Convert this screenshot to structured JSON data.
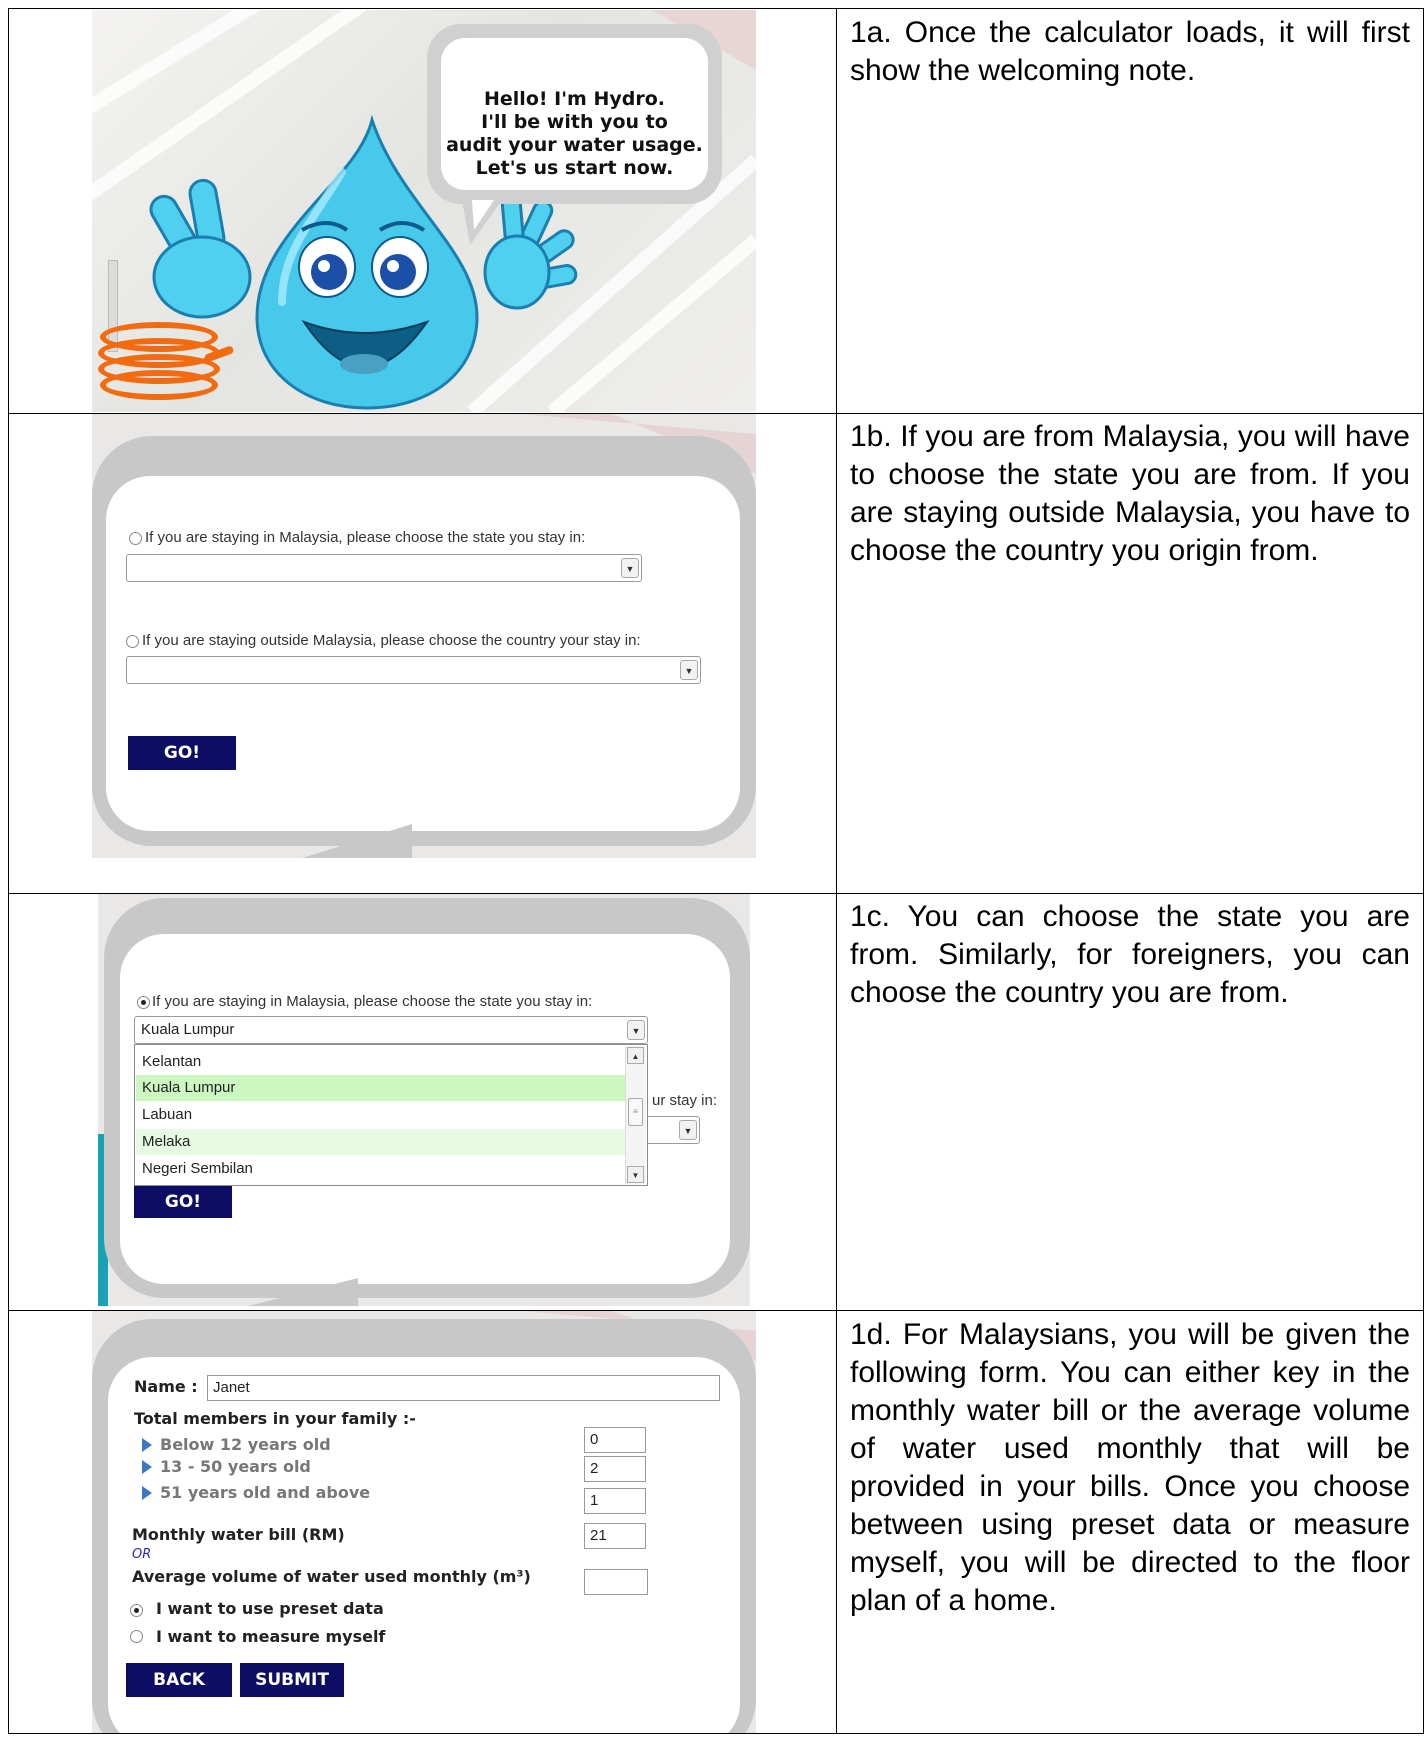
{
  "panelA": {
    "bubble_lines": [
      "Hello! I'm Hydro.",
      "I'll be with you to",
      "audit your water usage.",
      "Let's us start now."
    ],
    "description": "1a. Once the calculator loads, it will first show the welcoming note."
  },
  "panelB": {
    "malaysia_label": "If you are staying in Malaysia, please choose the state you stay in:",
    "outside_label": "If you are staying outside Malaysia, please choose the country your stay in:",
    "state_value": "",
    "country_value": "",
    "go_label": "GO!",
    "description": "1b. If you are from Malaysia, you will have to choose the state you are from. If you are staying outside Malaysia, you have to choose the country you origin from."
  },
  "panelC": {
    "malaysia_label": "If you are staying in Malaysia, please choose the state you stay in:",
    "state_value": "Kuala Lumpur",
    "options": [
      "Kelantan",
      "Kuala Lumpur",
      "Labuan",
      "Melaka",
      "Negeri Sembilan"
    ],
    "outside_label_partial": "ur stay in:",
    "go_label": "GO!",
    "description": "1c. You can choose the state you are from. Similarly, for foreigners, you can choose the country you are from."
  },
  "panelD": {
    "name_label": "Name :",
    "name_value": "Janet",
    "family_label": "Total members in your family :-",
    "age_groups": [
      {
        "label": "Below 12 years old",
        "value": "0"
      },
      {
        "label": "13 - 50 years old",
        "value": "2"
      },
      {
        "label": "51 years old and above",
        "value": "1"
      }
    ],
    "bill_label": "Monthly water bill (RM)",
    "bill_value": "21",
    "or_label": "OR",
    "volume_label": "Average volume of water used monthly (m³)",
    "volume_value": "",
    "preset_label": "I want to use preset data",
    "measure_label": "I want to measure myself",
    "back_label": "BACK",
    "submit_label": "SUBMIT",
    "description": "1d. For Malaysians, you will be given the following form. You can either key in the monthly water bill or the average volume of water used monthly that will be provided in your bills. Once you choose between using preset data or measure myself, you will be directed to the floor plan of a home."
  }
}
